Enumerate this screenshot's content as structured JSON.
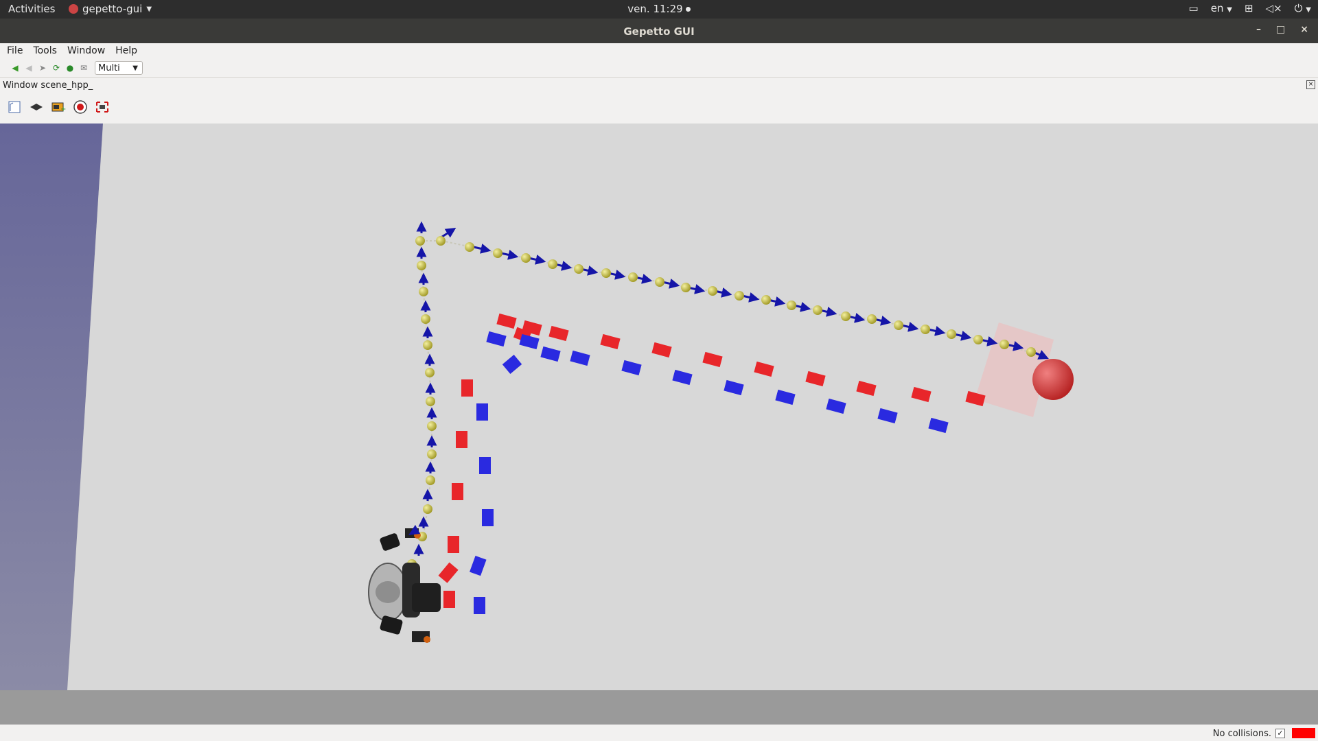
{
  "topbar": {
    "activities": "Activities",
    "app_name": "gepetto-gui",
    "clock": "ven. 11:29",
    "language": "en"
  },
  "window": {
    "title": "Gepetto GUI",
    "minimize": "–",
    "maximize": "□",
    "close": "×"
  },
  "menu": {
    "file": "File",
    "tools": "Tools",
    "window": "Window",
    "help": "Help"
  },
  "toolbar": {
    "mode_value": "Multi"
  },
  "dock": {
    "title": "Window scene_hpp_"
  },
  "status": {
    "collision_text": "No collisions.",
    "checkbox": "✓",
    "collision_color": "#ff0000"
  },
  "scene": {
    "ground_color": "#d8d8d8",
    "sky_color": "#666699",
    "footstep_left_color": "#e8262a",
    "footstep_right_color": "#2a2ae0",
    "waypoint_color": "#d6cf4a",
    "arrow_color": "#1515a8",
    "goal_color": "#d83535"
  }
}
